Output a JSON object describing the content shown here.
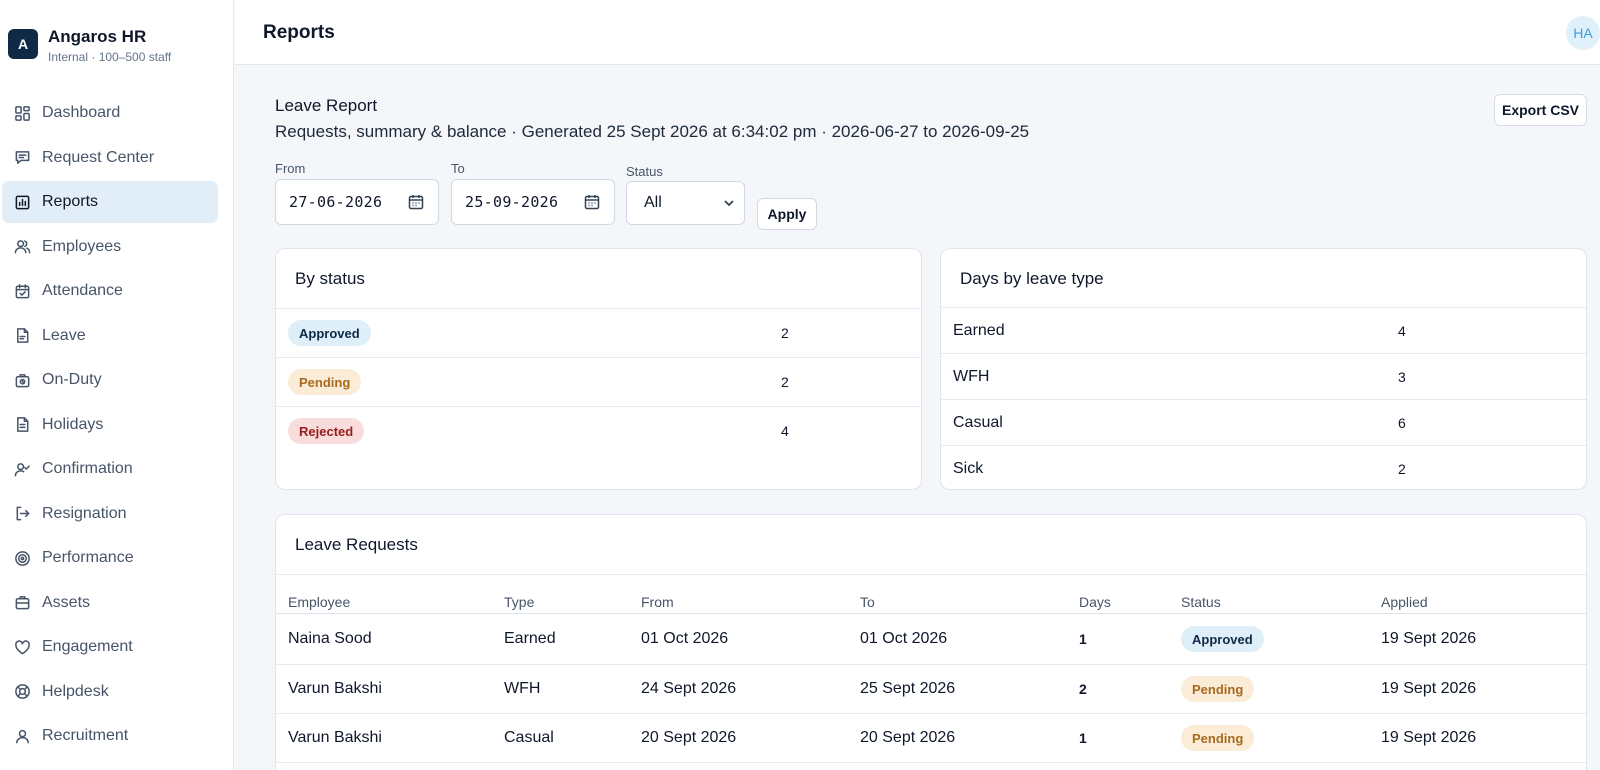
{
  "brand": {
    "logo_letter": "A",
    "name": "Angaros HR",
    "subtitle": "Internal · 100–500 staff"
  },
  "sidebar": {
    "items": [
      {
        "label": "Dashboard",
        "icon": "dashboard-icon"
      },
      {
        "label": "Request Center",
        "icon": "message-icon"
      },
      {
        "label": "Reports",
        "icon": "bar-chart-icon",
        "active": true
      },
      {
        "label": "Employees",
        "icon": "users-icon"
      },
      {
        "label": "Attendance",
        "icon": "calendar-check-icon"
      },
      {
        "label": "Leave",
        "icon": "file-icon"
      },
      {
        "label": "On-Duty",
        "icon": "briefcase-clock-icon"
      },
      {
        "label": "Holidays",
        "icon": "file-text-icon"
      },
      {
        "label": "Confirmation",
        "icon": "user-check-icon"
      },
      {
        "label": "Resignation",
        "icon": "logout-icon"
      },
      {
        "label": "Performance",
        "icon": "target-icon"
      },
      {
        "label": "Assets",
        "icon": "briefcase-icon"
      },
      {
        "label": "Engagement",
        "icon": "heart-icon"
      },
      {
        "label": "Helpdesk",
        "icon": "lifebuoy-icon"
      },
      {
        "label": "Recruitment",
        "icon": "user-icon"
      }
    ]
  },
  "header": {
    "title": "Reports",
    "avatar_initials": "HA"
  },
  "report": {
    "title": "Leave Report",
    "subtitle": "Requests, summary & balance · Generated 25 Sept 2026 at 6:34:02 pm · 2026-06-27 to 2026-09-25",
    "export_label": "Export CSV"
  },
  "filters": {
    "from_label": "From",
    "from_value": "27-06-2026",
    "to_label": "To",
    "to_value": "25-09-2026",
    "status_label": "Status",
    "status_value": "All",
    "apply_label": "Apply"
  },
  "by_status": {
    "title": "By status",
    "rows": [
      {
        "status": "Approved",
        "count": "2"
      },
      {
        "status": "Pending",
        "count": "2"
      },
      {
        "status": "Rejected",
        "count": "4"
      }
    ]
  },
  "by_type": {
    "title": "Days by leave type",
    "rows": [
      {
        "type": "Earned",
        "days": "4"
      },
      {
        "type": "WFH",
        "days": "3"
      },
      {
        "type": "Casual",
        "days": "6"
      },
      {
        "type": "Sick",
        "days": "2"
      }
    ]
  },
  "requests": {
    "title": "Leave Requests",
    "columns": [
      "Employee",
      "Type",
      "From",
      "To",
      "Days",
      "Status",
      "Applied"
    ],
    "rows": [
      {
        "employee": "Naina Sood",
        "type": "Earned",
        "from": "01 Oct 2026",
        "to": "01 Oct 2026",
        "days": "1",
        "status": "Approved",
        "applied": "19 Sept 2026"
      },
      {
        "employee": "Varun Bakshi",
        "type": "WFH",
        "from": "24 Sept 2026",
        "to": "25 Sept 2026",
        "days": "2",
        "status": "Pending",
        "applied": "19 Sept 2026"
      },
      {
        "employee": "Varun Bakshi",
        "type": "Casual",
        "from": "20 Sept 2026",
        "to": "20 Sept 2026",
        "days": "1",
        "status": "Pending",
        "applied": "19 Sept 2026"
      }
    ]
  },
  "colors": {
    "brand": "#0f2a44",
    "active_nav": "#e1eef8",
    "approved": "#dfeffa",
    "pending": "#fbecd8",
    "rejected": "#f9dcdc"
  }
}
